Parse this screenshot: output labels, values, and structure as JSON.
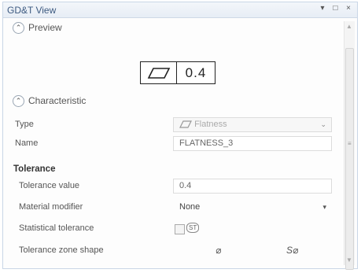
{
  "window": {
    "title": "GD&T View",
    "controls": {
      "pin": "▾",
      "restore": "□",
      "close": "×"
    }
  },
  "preview": {
    "section_label": "Preview",
    "collapse_glyph": "⌃",
    "frame": {
      "symbol_icon": "flatness-parallelogram-icon",
      "value": "0.4"
    }
  },
  "characteristic": {
    "section_label": "Characteristic",
    "collapse_glyph": "⌃",
    "type": {
      "label": "Type",
      "value": "Flatness",
      "icon": "flatness-icon",
      "dropdown_glyph": "⌄"
    },
    "name": {
      "label": "Name",
      "value": "FLATNESS_3"
    }
  },
  "tolerance": {
    "heading": "Tolerance",
    "value": {
      "label": "Tolerance value",
      "value": "0.4"
    },
    "material_modifier": {
      "label": "Material modifier",
      "value": "None",
      "dropdown_glyph": "▾"
    },
    "statistical": {
      "label": "Statistical tolerance",
      "checked": false,
      "icon_text": "ST"
    },
    "zone_shape": {
      "label": "Tolerance zone shape",
      "options": [
        "⌀",
        "S⌀"
      ]
    }
  },
  "scrollbar": {
    "up": "▲",
    "down": "▼",
    "grip": "≡"
  }
}
